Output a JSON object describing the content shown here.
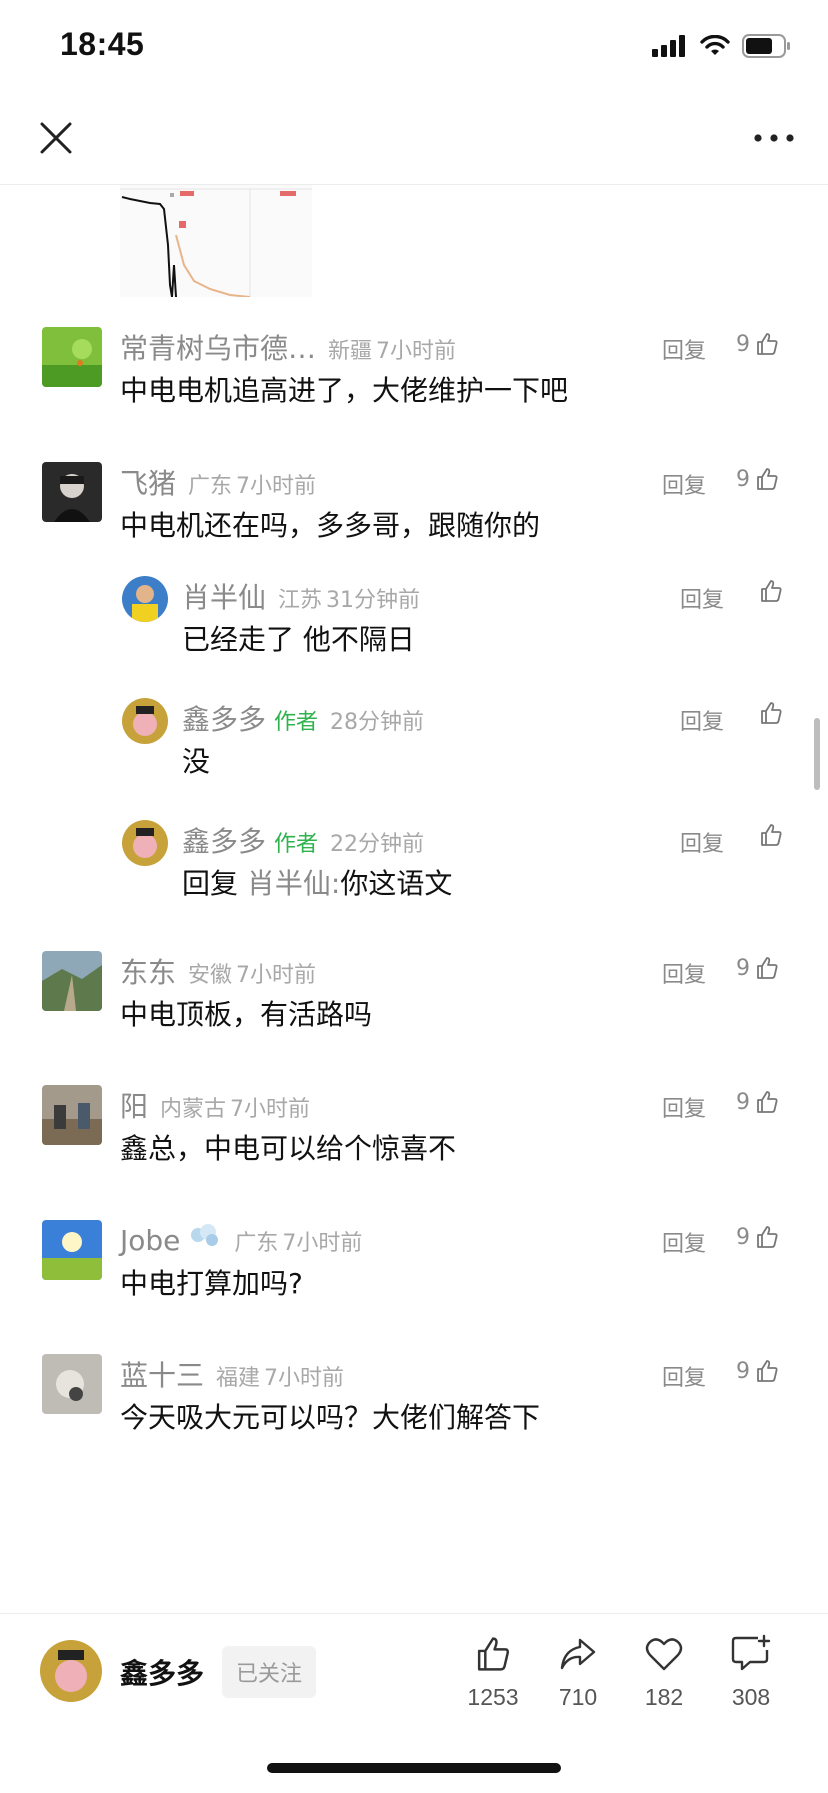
{
  "status": {
    "time": "18:45"
  },
  "comments": [
    {
      "user": "常青树乌市德…",
      "location": "新疆",
      "time": "7小时前",
      "text": "中电电机追高进了，大佬维护一下吧",
      "reply": "回复",
      "likes": "9"
    },
    {
      "user": "飞猪",
      "location": "广东",
      "time": "7小时前",
      "text": "中电机还在吗，多多哥，跟随你的",
      "reply": "回复",
      "likes": "9",
      "replies": [
        {
          "user": "肖半仙",
          "location": "江苏",
          "time": "31分钟前",
          "text": "已经走了 他不隔日",
          "reply": "回复"
        },
        {
          "user": "鑫多多",
          "author_tag": "作者",
          "time": "28分钟前",
          "text": "没",
          "reply": "回复"
        },
        {
          "user": "鑫多多",
          "author_tag": "作者",
          "time": "22分钟前",
          "text_prefix": "回复",
          "reply_to": "肖半仙:",
          "text": "你这语文",
          "reply": "回复"
        }
      ]
    },
    {
      "user": "东东",
      "location": "安徽",
      "time": "7小时前",
      "text": "中电顶板，有活路吗",
      "reply": "回复",
      "likes": "9"
    },
    {
      "user": "阳",
      "location": "内蒙古",
      "time": "7小时前",
      "text": "鑫总，中电可以给个惊喜不",
      "reply": "回复",
      "likes": "9"
    },
    {
      "user": "Jobe",
      "location": "广东",
      "time": "7小时前",
      "text": "中电打算加吗?",
      "reply": "回复",
      "likes": "9"
    },
    {
      "user": "蓝十三",
      "location": "福建",
      "time": "7小时前",
      "text": "今天吸大元可以吗？大佬们解答下",
      "reply": "回复",
      "likes": "9"
    }
  ],
  "bottom_bar": {
    "author": "鑫多多",
    "follow_label": "已关注",
    "like_count": "1253",
    "share_count": "710",
    "favorite_count": "182",
    "comment_count": "308"
  },
  "colors": {
    "author_tag": "#2fb34d",
    "muted": "#8a8a8a"
  },
  "icons": [
    "close-icon",
    "more-icon",
    "thumb-up-icon",
    "share-icon",
    "heart-icon",
    "comment-add-icon"
  ]
}
